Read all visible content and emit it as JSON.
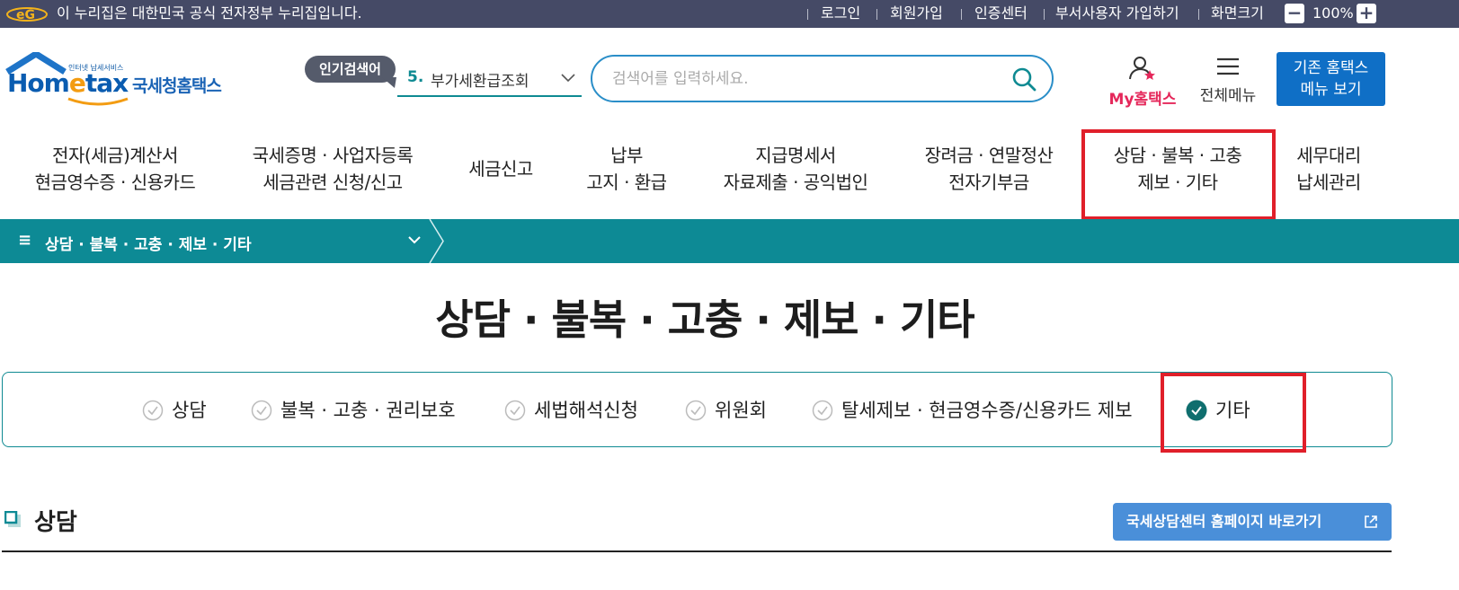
{
  "govbar": {
    "notice": "이 누리집은 대한민국 공식 전자정부 누리집입니다.",
    "links": {
      "login": "로그인",
      "join": "회원가입",
      "cert": "인증센터",
      "dept_join": "부서사용자 가입하기",
      "zoom_label": "화면크기"
    },
    "zoom_minus": "−",
    "zoom_value": "100%",
    "zoom_plus": "+"
  },
  "header": {
    "logo": {
      "sub": "인터넷 납세서비스",
      "home_a": "Hom",
      "home_e": "e",
      "home_b": "tax",
      "kr": "국세청홈택스"
    },
    "popular_badge": "인기검색어",
    "popular_rank": "5.",
    "popular_term": "부가세환급조회",
    "search_placeholder": "검색어를 입력하세요.",
    "my_hometax": "My홈택스",
    "all_menu": "전체메뉴",
    "old_menu_line1": "기존 홈택스",
    "old_menu_line2": "메뉴 보기"
  },
  "gnb": [
    {
      "l1": "전자(세금)계산서",
      "l2": "현금영수증 · 신용카드"
    },
    {
      "l1": "국세증명 · 사업자등록",
      "l2": "세금관련 신청/신고"
    },
    {
      "l1": "세금신고",
      "l2": ""
    },
    {
      "l1": "납부",
      "l2": "고지 · 환급"
    },
    {
      "l1": "지급명세서",
      "l2": "자료제출 · 공익법인"
    },
    {
      "l1": "장려금 · 연말정산",
      "l2": "전자기부금"
    },
    {
      "l1": "상담 · 불복 · 고충",
      "l2": "제보 · 기타"
    },
    {
      "l1": "세무대리",
      "l2": "납세관리"
    }
  ],
  "breadcrumb": {
    "current": "상담 · 불복 · 고충 · 제보 · 기타"
  },
  "page_title": "상담 · 불복 · 고충 · 제보 · 기타",
  "tabs": [
    {
      "label": "상담",
      "selected": false
    },
    {
      "label": "불복 · 고충 · 권리보호",
      "selected": false
    },
    {
      "label": "세법해석신청",
      "selected": false
    },
    {
      "label": "위원회",
      "selected": false
    },
    {
      "label": "탈세제보 · 현금영수증/신용카드 제보",
      "selected": false
    },
    {
      "label": "기타",
      "selected": true
    }
  ],
  "section": {
    "title": "상담",
    "link_button": "국세상담센터 홈페이지 바로가기"
  },
  "colors": {
    "govbar": "#454a66",
    "teal": "#0d8a95",
    "highlight": "#e01f2a",
    "accent_blue": "#0f6fc6",
    "my_pink": "#e5275a"
  }
}
